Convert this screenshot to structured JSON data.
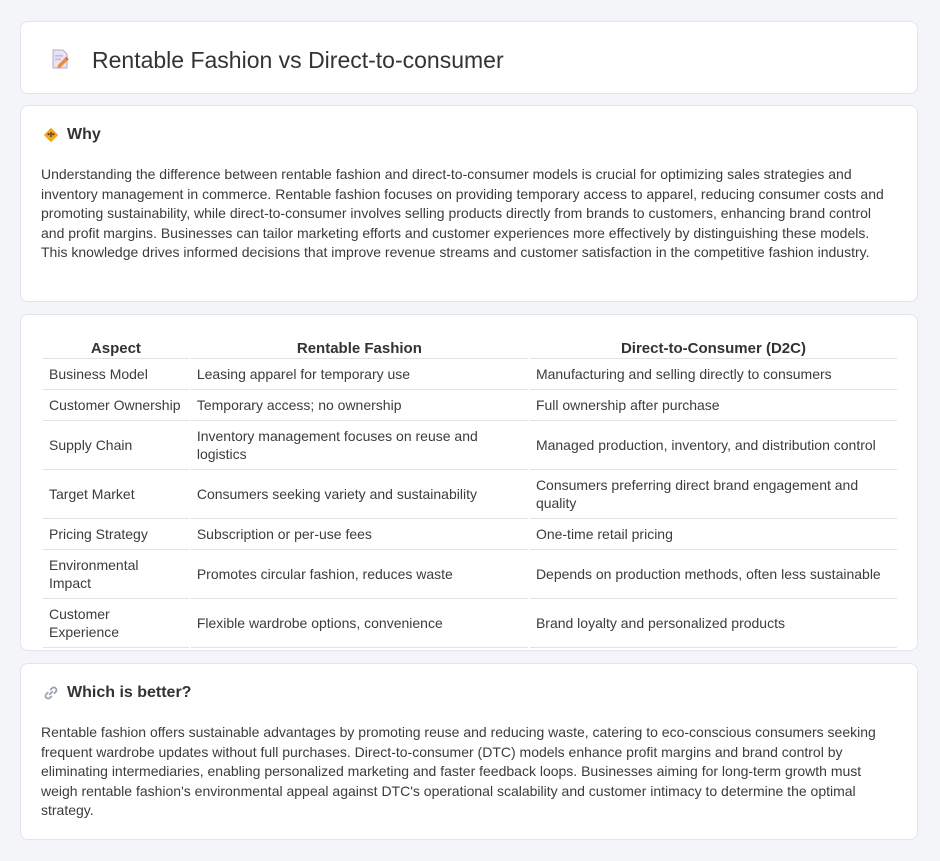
{
  "header": {
    "title": "Rentable Fashion vs Direct-to-consumer",
    "icon": "pencil-document-icon"
  },
  "why": {
    "heading": "Why",
    "icon": "lightbulb-icon",
    "text": "Understanding the difference between rentable fashion and direct-to-consumer models is crucial for optimizing sales strategies and inventory management in commerce. Rentable fashion focuses on providing temporary access to apparel, reducing consumer costs and promoting sustainability, while direct-to-consumer involves selling products directly from brands to customers, enhancing brand control and profit margins. Businesses can tailor marketing efforts and customer experiences more effectively by distinguishing these models. This knowledge drives informed decisions that improve revenue streams and customer satisfaction in the competitive fashion industry."
  },
  "table": {
    "headers": [
      "Aspect",
      "Rentable Fashion",
      "Direct-to-Consumer (D2C)"
    ],
    "rows": [
      {
        "aspect": "Business Model",
        "rentable": "Leasing apparel for temporary use",
        "d2c": "Manufacturing and selling directly to consumers"
      },
      {
        "aspect": "Customer Ownership",
        "rentable": "Temporary access; no ownership",
        "d2c": "Full ownership after purchase"
      },
      {
        "aspect": "Supply Chain",
        "rentable": "Inventory management focuses on reuse and logistics",
        "d2c": "Managed production, inventory, and distribution control"
      },
      {
        "aspect": "Target Market",
        "rentable": "Consumers seeking variety and sustainability",
        "d2c": "Consumers preferring direct brand engagement and quality"
      },
      {
        "aspect": "Pricing Strategy",
        "rentable": "Subscription or per-use fees",
        "d2c": "One-time retail pricing"
      },
      {
        "aspect": "Environmental Impact",
        "rentable": "Promotes circular fashion, reduces waste",
        "d2c": "Depends on production methods, often less sustainable"
      },
      {
        "aspect": "Customer Experience",
        "rentable": "Flexible wardrobe options, convenience",
        "d2c": "Brand loyalty and personalized products"
      }
    ]
  },
  "better": {
    "heading": "Which is better?",
    "icon": "link-icon",
    "text": "Rentable fashion offers sustainable advantages by promoting reuse and reducing waste, catering to eco-conscious consumers seeking frequent wardrobe updates without full purchases. Direct-to-consumer (DTC) models enhance profit margins and brand control by eliminating intermediaries, enabling personalized marketing and faster feedback loops. Businesses aiming for long-term growth must weigh rentable fashion's environmental appeal against DTC's operational scalability and customer intimacy to determine the optimal strategy."
  }
}
